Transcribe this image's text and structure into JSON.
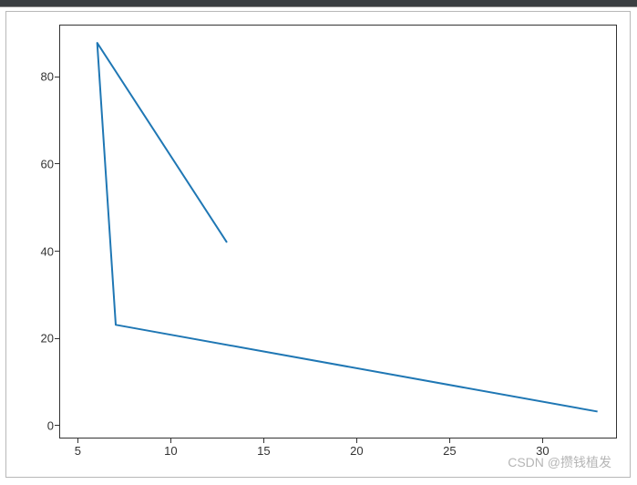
{
  "chart_data": {
    "type": "line",
    "x": [
      13,
      6,
      7,
      33
    ],
    "y": [
      42,
      88,
      23,
      3
    ],
    "xlim": [
      4,
      34
    ],
    "ylim": [
      -3,
      92
    ],
    "xticks": [
      5,
      10,
      15,
      20,
      25,
      30
    ],
    "yticks": [
      0,
      20,
      40,
      60,
      80
    ],
    "line_color": "#1f77b4",
    "title": "",
    "xlabel": "",
    "ylabel": ""
  },
  "watermark": "CSDN @攒钱植发"
}
